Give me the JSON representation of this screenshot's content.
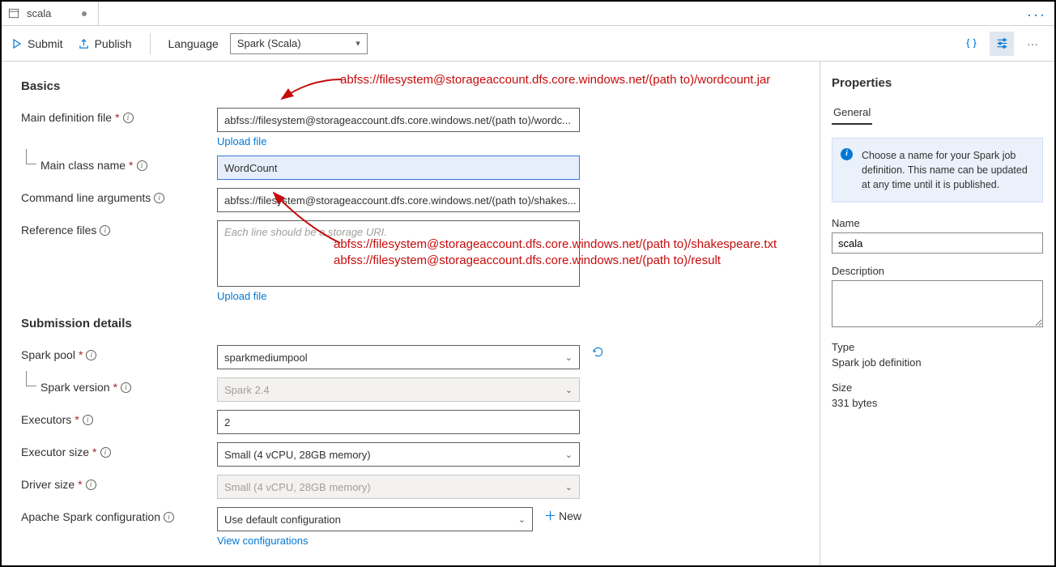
{
  "tab": {
    "title": "scala"
  },
  "toolbar": {
    "submit": "Submit",
    "publish": "Publish",
    "language_label": "Language",
    "language_value": "Spark (Scala)"
  },
  "sections": {
    "basics": "Basics",
    "submission": "Submission details"
  },
  "labels": {
    "main_def": "Main definition file",
    "main_class": "Main class name",
    "cmd_args": "Command line arguments",
    "ref_files": "Reference files",
    "spark_pool": "Spark pool",
    "spark_version": "Spark version",
    "executors": "Executors",
    "executor_size": "Executor size",
    "driver_size": "Driver size",
    "apache_conf": "Apache Spark configuration"
  },
  "fields": {
    "main_def": "abfss://filesystem@storageaccount.dfs.core.windows.net/(path to)/wordc...",
    "main_class": "WordCount",
    "cmd_args": "abfss://filesystem@storageaccount.dfs.core.windows.net/(path to)/shakes...",
    "ref_files_placeholder": "Each line should be a storage URI.",
    "spark_pool": "sparkmediumpool",
    "spark_version": "Spark 2.4",
    "executors": "2",
    "executor_size": "Small (4 vCPU, 28GB memory)",
    "driver_size": "Small (4 vCPU, 28GB memory)",
    "apache_conf": "Use default configuration"
  },
  "links": {
    "upload_file": "Upload file",
    "new": "New",
    "view_configs": "View configurations"
  },
  "annotations": {
    "a1": "abfss://filesystem@storageaccount.dfs.core.windows.net/(path to)/wordcount.jar",
    "a2": "abfss://filesystem@storageaccount.dfs.core.windows.net/(path to)/shakespeare.txt",
    "a3": "abfss://filesystem@storageaccount.dfs.core.windows.net/(path to)/result"
  },
  "properties": {
    "title": "Properties",
    "general_tab": "General",
    "info": "Choose a name for your Spark job definition. This name can be updated at any time until it is published.",
    "name_label": "Name",
    "name_value": "scala",
    "desc_label": "Description",
    "type_label": "Type",
    "type_value": "Spark job definition",
    "size_label": "Size",
    "size_value": "331 bytes"
  }
}
